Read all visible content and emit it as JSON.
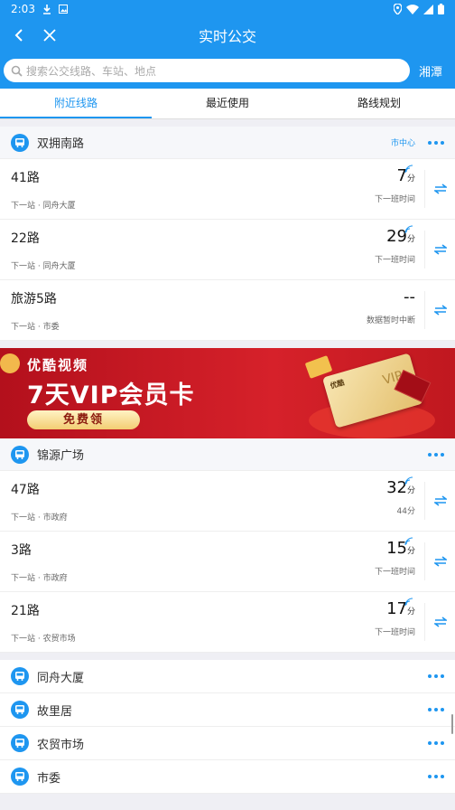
{
  "status": {
    "time": "2:03"
  },
  "header": {
    "title": "实时公交"
  },
  "search": {
    "placeholder": "搜索公交线路、车站、地点",
    "city": "湘潭"
  },
  "tabs": [
    {
      "label": "附近线路"
    },
    {
      "label": "最近使用"
    },
    {
      "label": "路线规划"
    }
  ],
  "stops": [
    {
      "name": "双拥南路",
      "tag": "市中心",
      "routes": [
        {
          "name": "41路",
          "next": "下一站 · 同舟大厦",
          "eta": "7",
          "unit": "分",
          "sub": "下一班时间"
        },
        {
          "name": "22路",
          "next": "下一站 · 同舟大厦",
          "eta": "29",
          "unit": "分",
          "sub": "下一班时间"
        },
        {
          "name": "旅游5路",
          "next": "下一站 · 市委",
          "eta": "--",
          "unit": "",
          "sub": "数据暂时中断"
        }
      ]
    },
    {
      "name": "锦源广场",
      "tag": "",
      "routes": [
        {
          "name": "47路",
          "next": "下一站 · 市政府",
          "eta": "32",
          "unit": "分",
          "sub": "44分"
        },
        {
          "name": "3路",
          "next": "下一站 · 市政府",
          "eta": "15",
          "unit": "分",
          "sub": "下一班时间"
        },
        {
          "name": "21路",
          "next": "下一站 · 农贸市场",
          "eta": "17",
          "unit": "分",
          "sub": "下一班时间"
        }
      ]
    }
  ],
  "banner": {
    "brand": "优酷视频",
    "headline": "7天VIP会员卡",
    "cta": "免费领",
    "card_brand": "优酷",
    "card_text": "VIP"
  },
  "other_stops": [
    {
      "name": "同舟大厦"
    },
    {
      "name": "故里居"
    },
    {
      "name": "农贸市场"
    },
    {
      "name": "市委"
    }
  ],
  "colors": {
    "primary": "#1e96f0",
    "banner": "#d6212a"
  }
}
